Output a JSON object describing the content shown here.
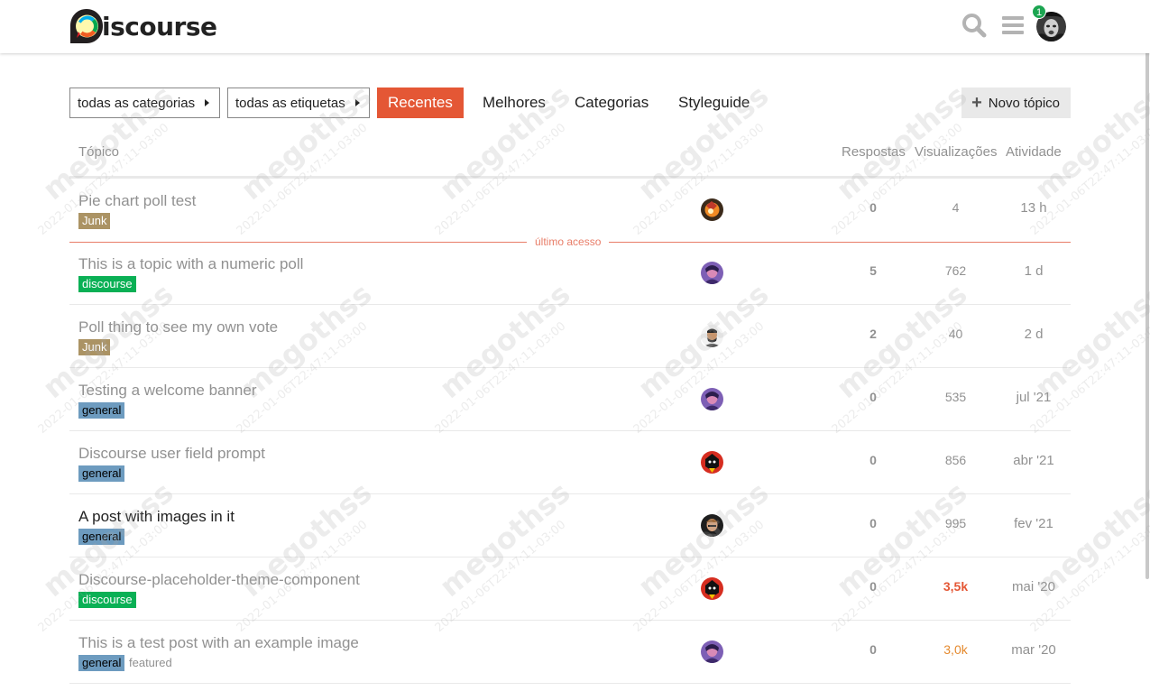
{
  "header": {
    "logo_text": "iscourse",
    "notification_count": "1",
    "icons": [
      "search-icon",
      "hamburger-menu-icon",
      "user-avatar"
    ]
  },
  "nav": {
    "categories_dropdown": "todas as categorias",
    "tags_dropdown": "todas as etiquetas",
    "tabs": [
      "Recentes",
      "Melhores",
      "Categorias",
      "Styleguide"
    ],
    "active_tab": "Recentes",
    "new_topic": "Novo tópico"
  },
  "table": {
    "headers": {
      "topic": "Tópico",
      "replies": "Respostas",
      "views": "Visualizações",
      "activity": "Atividade"
    },
    "last_visit_label": "último acesso",
    "rows": [
      {
        "title": "Pie chart poll test",
        "category": "Junk",
        "category_color": "#ab9364",
        "category_text_color": "#ffffff",
        "tag": "",
        "replies": "0",
        "views": "4",
        "activity": "13 h",
        "unread": false
      },
      {
        "title": "This is a topic with a numeric poll",
        "category": "discourse",
        "category_color": "#0ab055",
        "category_text_color": "#ffffff",
        "tag": "",
        "replies": "5",
        "views": "762",
        "activity": "1 d",
        "unread": false
      },
      {
        "title": "Poll thing to see my own vote",
        "category": "Junk",
        "category_color": "#ab9364",
        "category_text_color": "#ffffff",
        "tag": "",
        "replies": "2",
        "views": "40",
        "activity": "2 d",
        "unread": false
      },
      {
        "title": "Testing a welcome banner",
        "category": "general",
        "category_color": "#6d9bbf",
        "category_text_color": "#000000",
        "tag": "",
        "replies": "0",
        "views": "535",
        "activity": "jul '21",
        "unread": false
      },
      {
        "title": "Discourse user field prompt",
        "category": "general",
        "category_color": "#6d9bbf",
        "category_text_color": "#000000",
        "tag": "",
        "replies": "0",
        "views": "856",
        "activity": "abr '21",
        "unread": false
      },
      {
        "title": "A post with images in it",
        "category": "general",
        "category_color": "#6d9bbf",
        "category_text_color": "#000000",
        "tag": "",
        "replies": "0",
        "views": "995",
        "activity": "fev '21",
        "unread": true
      },
      {
        "title": "Discourse-placeholder-theme-component",
        "category": "discourse",
        "category_color": "#0ab055",
        "category_text_color": "#ffffff",
        "tag": "",
        "replies": "0",
        "views": "3,5k",
        "activity": "mai '20",
        "unread": false
      },
      {
        "title": "This is a test post with an example image",
        "category": "general",
        "category_color": "#6d9bbf",
        "category_text_color": "#000000",
        "tag": "featured",
        "replies": "0",
        "views": "3,0k",
        "activity": "mar '20",
        "unread": false
      }
    ]
  },
  "watermark": {
    "user": "megothss",
    "timestamp": "2022-01-06T22:47:11-03:00"
  }
}
